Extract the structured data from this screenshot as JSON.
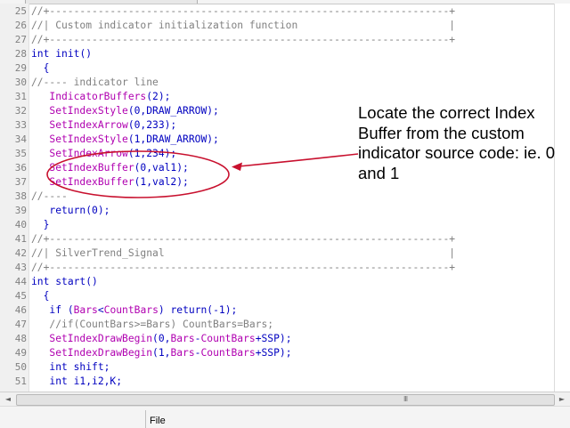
{
  "code_lines": [
    {
      "num": "25",
      "segments": [
        {
          "t": "//+------------------------------------------------------------------+",
          "c": "cm"
        }
      ]
    },
    {
      "num": "26",
      "segments": [
        {
          "t": "//| Custom indicator initialization function                         |",
          "c": "cm"
        }
      ]
    },
    {
      "num": "27",
      "segments": [
        {
          "t": "//+------------------------------------------------------------------+",
          "c": "cm"
        }
      ]
    },
    {
      "num": "28",
      "segments": [
        {
          "t": "int ",
          "c": "kw"
        },
        {
          "t": "init",
          "c": "kw"
        },
        {
          "t": "()",
          "c": "kw"
        }
      ]
    },
    {
      "num": "29",
      "segments": [
        {
          "t": "  {",
          "c": "kw"
        }
      ]
    },
    {
      "num": "30",
      "segments": [
        {
          "t": "//---- indicator line",
          "c": "cm"
        }
      ]
    },
    {
      "num": "31",
      "segments": [
        {
          "t": "   ",
          "c": "nm"
        },
        {
          "t": "IndicatorBuffers",
          "c": "fn"
        },
        {
          "t": "(2);",
          "c": "kw"
        }
      ]
    },
    {
      "num": "32",
      "segments": [
        {
          "t": "   ",
          "c": "nm"
        },
        {
          "t": "SetIndexStyle",
          "c": "fn"
        },
        {
          "t": "(0,DRAW_ARROW);",
          "c": "kw"
        }
      ]
    },
    {
      "num": "33",
      "segments": [
        {
          "t": "   ",
          "c": "nm"
        },
        {
          "t": "SetIndexArrow",
          "c": "fn"
        },
        {
          "t": "(0,233);",
          "c": "kw"
        }
      ]
    },
    {
      "num": "34",
      "segments": [
        {
          "t": "   ",
          "c": "nm"
        },
        {
          "t": "SetIndexStyle",
          "c": "fn"
        },
        {
          "t": "(1,DRAW_ARROW);",
          "c": "kw"
        }
      ]
    },
    {
      "num": "35",
      "segments": [
        {
          "t": "   ",
          "c": "nm"
        },
        {
          "t": "SetIndexArrow",
          "c": "fn"
        },
        {
          "t": "(1,234);",
          "c": "kw"
        }
      ]
    },
    {
      "num": "36",
      "segments": [
        {
          "t": "   ",
          "c": "nm"
        },
        {
          "t": "SetIndexBuffer",
          "c": "fn"
        },
        {
          "t": "(0,val1);",
          "c": "kw"
        }
      ]
    },
    {
      "num": "37",
      "segments": [
        {
          "t": "   ",
          "c": "nm"
        },
        {
          "t": "SetIndexBuffer",
          "c": "fn"
        },
        {
          "t": "(1,val2);",
          "c": "kw"
        }
      ]
    },
    {
      "num": "38",
      "segments": [
        {
          "t": "//----",
          "c": "cm"
        }
      ]
    },
    {
      "num": "39",
      "segments": [
        {
          "t": "   ",
          "c": "nm"
        },
        {
          "t": "return",
          "c": "kw"
        },
        {
          "t": "(0);",
          "c": "kw"
        }
      ]
    },
    {
      "num": "40",
      "segments": [
        {
          "t": "  }",
          "c": "kw"
        }
      ]
    },
    {
      "num": "41",
      "segments": [
        {
          "t": "//+------------------------------------------------------------------+",
          "c": "cm"
        }
      ]
    },
    {
      "num": "42",
      "segments": [
        {
          "t": "//| SilverTrend_Signal                                               |",
          "c": "cm"
        }
      ]
    },
    {
      "num": "43",
      "segments": [
        {
          "t": "//+------------------------------------------------------------------+",
          "c": "cm"
        }
      ]
    },
    {
      "num": "44",
      "segments": [
        {
          "t": "int ",
          "c": "kw"
        },
        {
          "t": "start",
          "c": "kw"
        },
        {
          "t": "()",
          "c": "kw"
        }
      ]
    },
    {
      "num": "45",
      "segments": [
        {
          "t": "  {",
          "c": "kw"
        }
      ]
    },
    {
      "num": "46",
      "segments": [
        {
          "t": "   ",
          "c": "nm"
        },
        {
          "t": "if",
          "c": "kw"
        },
        {
          "t": " (",
          "c": "kw"
        },
        {
          "t": "Bars",
          "c": "fn"
        },
        {
          "t": "<",
          "c": "kw"
        },
        {
          "t": "CountBars",
          "c": "fn"
        },
        {
          "t": ") ",
          "c": "kw"
        },
        {
          "t": "return",
          "c": "kw"
        },
        {
          "t": "(-1);",
          "c": "kw"
        }
      ]
    },
    {
      "num": "47",
      "segments": [
        {
          "t": "   ",
          "c": "nm"
        },
        {
          "t": "//if(CountBars>=Bars) CountBars=Bars;",
          "c": "cm"
        }
      ]
    },
    {
      "num": "48",
      "segments": [
        {
          "t": "   ",
          "c": "nm"
        },
        {
          "t": "SetIndexDrawBegin",
          "c": "fn"
        },
        {
          "t": "(0,",
          "c": "kw"
        },
        {
          "t": "Bars",
          "c": "fn"
        },
        {
          "t": "-",
          "c": "kw"
        },
        {
          "t": "CountBars",
          "c": "fn"
        },
        {
          "t": "+SSP);",
          "c": "kw"
        }
      ]
    },
    {
      "num": "49",
      "segments": [
        {
          "t": "   ",
          "c": "nm"
        },
        {
          "t": "SetIndexDrawBegin",
          "c": "fn"
        },
        {
          "t": "(1,",
          "c": "kw"
        },
        {
          "t": "Bars",
          "c": "fn"
        },
        {
          "t": "-",
          "c": "kw"
        },
        {
          "t": "CountBars",
          "c": "fn"
        },
        {
          "t": "+SSP);",
          "c": "kw"
        }
      ]
    },
    {
      "num": "50",
      "segments": [
        {
          "t": "   ",
          "c": "nm"
        },
        {
          "t": "int",
          "c": "kw"
        },
        {
          "t": " shift;",
          "c": "kw"
        }
      ]
    },
    {
      "num": "51",
      "segments": [
        {
          "t": "   ",
          "c": "nm"
        },
        {
          "t": "int",
          "c": "kw"
        },
        {
          "t": " i1,i2,K;",
          "c": "kw"
        }
      ]
    }
  ],
  "annotation": {
    "text": "Locate the correct Index Buffer from the custom indicator source code: ie. 0 and 1",
    "color": "#c8102e"
  },
  "footer": {
    "tab_label": "File"
  },
  "scrollbar": {
    "left_arrow": "◄",
    "right_arrow": "►",
    "grip": "III"
  }
}
